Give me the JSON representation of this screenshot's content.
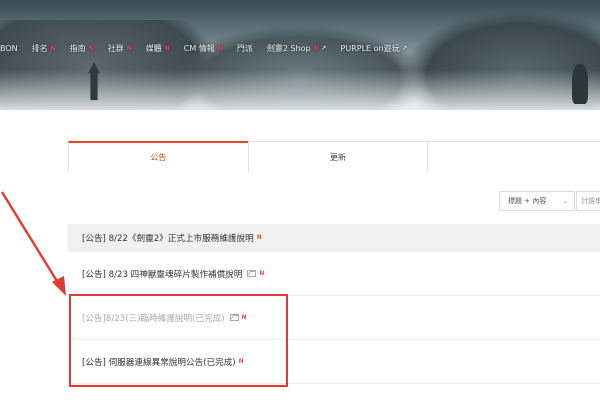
{
  "nav": {
    "items": [
      {
        "label": "BON",
        "new": "",
        "ext": ""
      },
      {
        "label": "排名",
        "new": "N",
        "ext": ""
      },
      {
        "label": "指南",
        "new": "N",
        "ext": ""
      },
      {
        "label": "社群",
        "new": "N",
        "ext": ""
      },
      {
        "label": "媒體",
        "new": "N",
        "ext": ""
      },
      {
        "label": "CM 情報",
        "new": "N",
        "ext": ""
      },
      {
        "label": "門派",
        "new": "",
        "ext": ""
      },
      {
        "label": "劍靈2 Shop",
        "new": "N",
        "ext": "↗"
      },
      {
        "label": "PURPLE on遊玩",
        "new": "",
        "ext": "↗"
      }
    ]
  },
  "tabs": [
    {
      "label": "公告",
      "active": true
    },
    {
      "label": "更新",
      "active": false
    },
    {
      "label": "",
      "active": false
    }
  ],
  "search": {
    "select_value": "標題 + 內容",
    "input_placeholder": "討論串"
  },
  "posts": [
    {
      "title": "[公告] 8/22《劍靈2》正式上市服務維護說明",
      "new": "N",
      "has_image": false
    },
    {
      "title": "[公告] 8/23 四神獸靈魂碎片製作補償說明",
      "new": "N",
      "has_image": true
    },
    {
      "title": "[公告]8/23(三)臨時維護說明(已完成)",
      "new": "N",
      "has_image": true
    },
    {
      "title": "[公告] 伺服器連線異常說明公告(已完成)",
      "new": "N",
      "has_image": false
    }
  ],
  "colors": {
    "accent": "#e04a22",
    "annotation": "#e23a33",
    "new_mark": "#ff4b4b"
  }
}
